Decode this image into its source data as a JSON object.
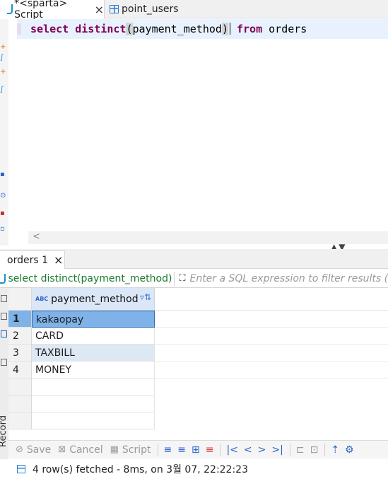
{
  "editor_tabs": [
    {
      "label": "*<sparta> Script",
      "active": true
    },
    {
      "label": "point_users",
      "active": false
    }
  ],
  "editor": {
    "keywords": [
      "select",
      "distinct",
      "from"
    ],
    "arg": "payment_method",
    "table": "orders"
  },
  "results_tab": {
    "label": "orders 1"
  },
  "filter": {
    "query": "select distinct(payment_method)",
    "placeholder": "Enter a SQL expression to filter results (use"
  },
  "grid": {
    "column": "payment_method",
    "column_type_badge": "ABC",
    "rows": [
      {
        "num": "1",
        "value": "kakaopay"
      },
      {
        "num": "2",
        "value": "CARD"
      },
      {
        "num": "3",
        "value": "TAXBILL"
      },
      {
        "num": "4",
        "value": "MONEY"
      }
    ]
  },
  "side_label": "Record",
  "toolbar": {
    "save": "Save",
    "cancel": "Cancel",
    "script": "Script"
  },
  "status": "4 row(s) fetched - 8ms, on 3월 07, 22:22:23",
  "colors": {
    "keyword": "#7f0055",
    "selection": "#7eb2e8",
    "accent": "#2a7bd2",
    "filter_text": "#1a7a2e"
  }
}
